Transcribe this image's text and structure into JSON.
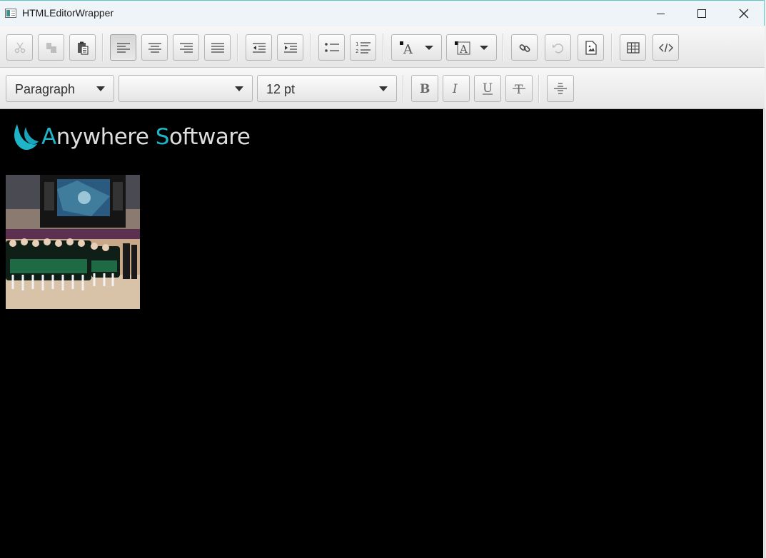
{
  "window": {
    "title": "HTMLEditorWrapper"
  },
  "toolbar": {
    "paragraph_style": "Paragraph",
    "font_family": "",
    "font_size": "12 pt"
  },
  "editor": {
    "logo": {
      "first_letter": "A",
      "word1_rest": "nywhere ",
      "second_letter": "S",
      "word2_rest": "oftware"
    },
    "colors": {
      "background": "#000000",
      "logo_accent": "#1fb5c9"
    }
  }
}
